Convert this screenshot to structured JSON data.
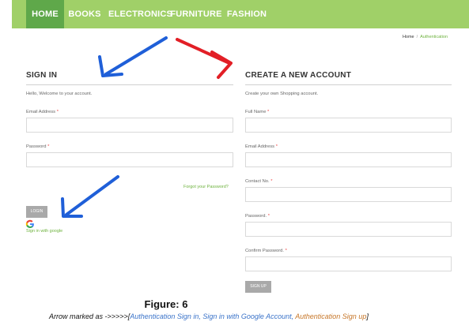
{
  "nav": {
    "items": [
      {
        "label": "HOME",
        "active": true
      },
      {
        "label": "BOOKS",
        "active": false
      },
      {
        "label": "ELECTRONICS",
        "active": false
      },
      {
        "label": "FURNITURE",
        "active": false
      },
      {
        "label": "FASHION",
        "active": false
      }
    ]
  },
  "breadcrumb": {
    "home": "Home",
    "separator": "/",
    "current": "Authentication"
  },
  "signin": {
    "title": "SIGN IN",
    "intro": "Hello, Welcome to your account.",
    "email_label": "Email Address",
    "password_label": "Password",
    "required_mark": "*",
    "forgot": "Forgot your Password?",
    "login_button": "LOGIN",
    "google_link": "Sign in with google"
  },
  "register": {
    "title": "CREATE A NEW ACCOUNT",
    "intro": "Create your own Shopping account.",
    "full_name_label": "Full Name",
    "email_label": "Email Address",
    "contact_label": "Contact No.",
    "password_label": "Password.",
    "confirm_label": "Confirm Password.",
    "required_mark": "*",
    "signup_button": "SIGN UP"
  },
  "caption": {
    "figure": "Figure: 6",
    "prefix": "Arrow marked as ->>>>>[",
    "part1": "Authentication Sign in,",
    "part2": " Sign in with Google Account,",
    "part3": " Authentication Sign up",
    "suffix": "]"
  },
  "colors": {
    "nav_bg": "#a0d068",
    "nav_active": "#5fa84a",
    "arrow_blue": "#1f5fd8",
    "arrow_red": "#e21f26",
    "accent_green": "#6db23d",
    "button_gray": "#a9a9a9"
  }
}
